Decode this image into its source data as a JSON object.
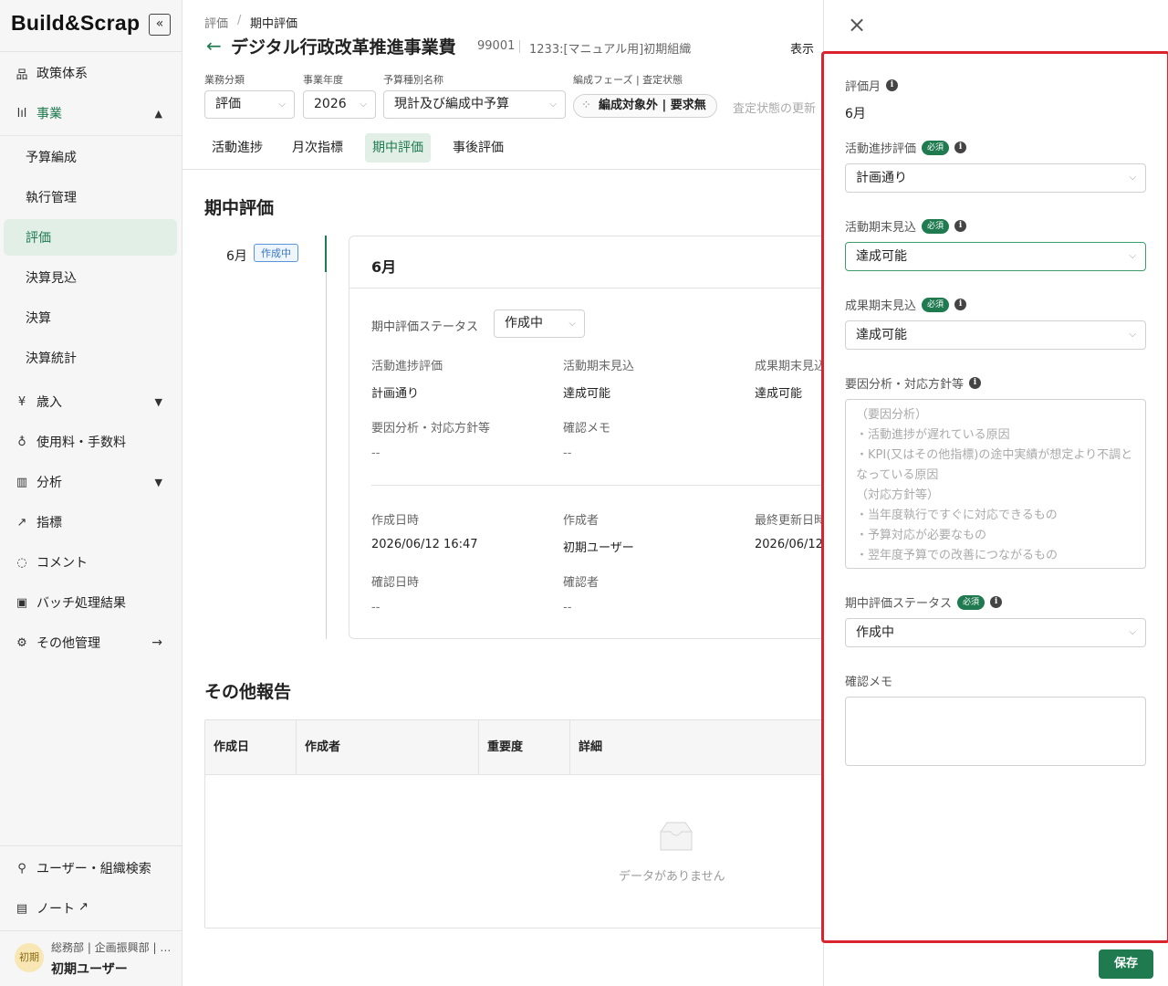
{
  "logo": {
    "text": "Build&Scrap"
  },
  "sidebar": {
    "collapse": "«",
    "items": [
      {
        "label": "政策体系"
      },
      {
        "label": "事業"
      },
      {
        "label": "歳入"
      },
      {
        "label": "使用料・手数料"
      },
      {
        "label": "分析"
      },
      {
        "label": "指標"
      },
      {
        "label": "コメント"
      },
      {
        "label": "バッチ処理結果"
      },
      {
        "label": "その他管理"
      }
    ],
    "subitems": [
      {
        "label": "予算編成"
      },
      {
        "label": "執行管理"
      },
      {
        "label": "評価"
      },
      {
        "label": "決算見込"
      },
      {
        "label": "決算"
      },
      {
        "label": "決算統計"
      }
    ],
    "bottom": [
      {
        "label": "ユーザー・組織検索"
      },
      {
        "label": "ノート"
      }
    ],
    "user": {
      "avatar": "初期",
      "org": "総務部 | 企画振興部 | …",
      "name": "初期ユーザー"
    }
  },
  "header": {
    "breadcrumb_root": "評価",
    "breadcrumb_sep": "/",
    "breadcrumb_current": "期中評価",
    "title": "デジタル行政改革推進事業費",
    "code": "99001",
    "org": "1233:[マニュアル用]初期組織",
    "display": "表示"
  },
  "filters": {
    "category_label": "業務分類",
    "category_value": "評価",
    "year_label": "事業年度",
    "year_value": "2026",
    "budget_label": "予算種別名称",
    "budget_value": "現計及び編成中予算",
    "phase_label": "編成フェーズ | 査定状態",
    "phase_value": "編成対象外 | 要求無",
    "update_link": "査定状態の更新"
  },
  "tabs": [
    {
      "label": "活動進捗"
    },
    {
      "label": "月次指標"
    },
    {
      "label": "期中評価"
    },
    {
      "label": "事後評価"
    }
  ],
  "midterm": {
    "heading": "期中評価",
    "timeline_month": "6月",
    "timeline_status": "作成中",
    "card_title": "6月",
    "status_label": "期中評価ステータス",
    "status_value": "作成中",
    "fields": [
      {
        "label": "活動進捗評価",
        "value": "計画通り"
      },
      {
        "label": "活動期末見込",
        "value": "達成可能"
      },
      {
        "label": "成果期末見込",
        "value": "達成可能"
      },
      {
        "label": "要因分析・対応方針等",
        "value": "--"
      },
      {
        "label": "確認メモ",
        "value": "--"
      }
    ],
    "meta": [
      {
        "label": "作成日時",
        "value": "2026/06/12 16:47"
      },
      {
        "label": "作成者",
        "value": "初期ユーザー"
      },
      {
        "label": "最終更新日時",
        "value": "2026/06/12"
      },
      {
        "label": "確認日時",
        "value": "--"
      },
      {
        "label": "確認者",
        "value": "--"
      }
    ]
  },
  "other_reports": {
    "heading": "その他報告",
    "columns": [
      "作成日",
      "作成者",
      "重要度",
      "詳細"
    ],
    "empty_text": "データがありません"
  },
  "panel": {
    "close": "×",
    "required_badge": "必須",
    "month_label": "評価月",
    "month_value": "6月",
    "activity_label": "活動進捗評価",
    "activity_value": "計画通り",
    "activity_end_label": "活動期末見込",
    "activity_end_value": "達成可能",
    "outcome_label": "成果期末見込",
    "outcome_value": "達成可能",
    "analysis_label": "要因分析・対応方針等",
    "analysis_placeholder": "（要因分析）\n・活動進捗が遅れている原因\n・KPI(又はその他指標)の途中実績が想定より不調となっている原因\n（対応方針等）\n・当年度執行ですぐに対応できるもの\n・予算対応が必要なもの\n・翌年度予算での改善につながるもの",
    "status_label": "期中評価ステータス",
    "status_value": "作成中",
    "memo_label": "確認メモ",
    "memo_value": "",
    "save": "保存"
  },
  "colors": {
    "accent": "#1f7a4f",
    "highlight": "#d9232d",
    "nav_active_bg": "#e1efe7"
  }
}
